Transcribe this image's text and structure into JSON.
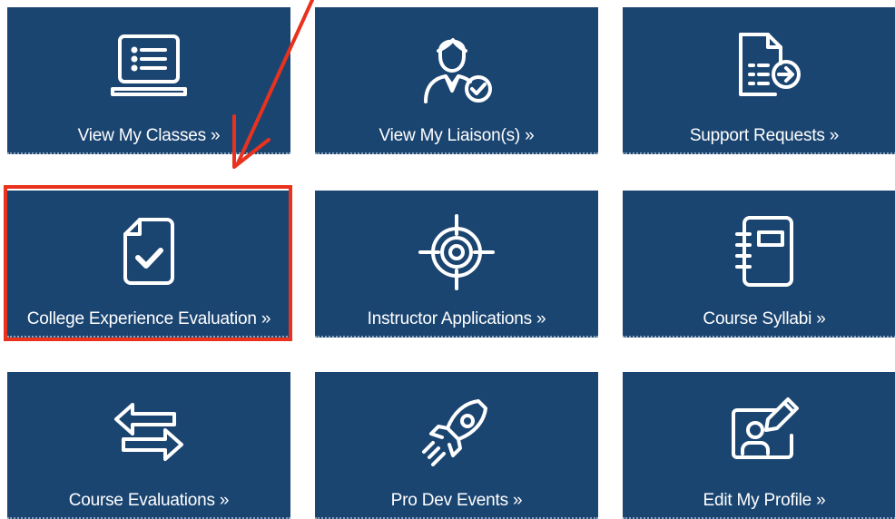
{
  "tiles": [
    {
      "label": "View My Classes »",
      "icon": "list-monitor-icon"
    },
    {
      "label": "View My Liaison(s) »",
      "icon": "person-check-icon"
    },
    {
      "label": "Support Requests »",
      "icon": "document-arrow-icon"
    },
    {
      "label": "College Experience Evaluation »",
      "icon": "document-check-icon"
    },
    {
      "label": "Instructor Applications »",
      "icon": "target-icon"
    },
    {
      "label": "Course Syllabi »",
      "icon": "notebook-icon"
    },
    {
      "label": "Course Evaluations »",
      "icon": "exchange-arrows-icon"
    },
    {
      "label": "Pro Dev Events »",
      "icon": "rocket-icon"
    },
    {
      "label": "Edit My Profile »",
      "icon": "profile-edit-icon"
    }
  ],
  "colors": {
    "tile_bg": "#1b4571",
    "text": "#ffffff",
    "annotation": "#e8321e"
  }
}
